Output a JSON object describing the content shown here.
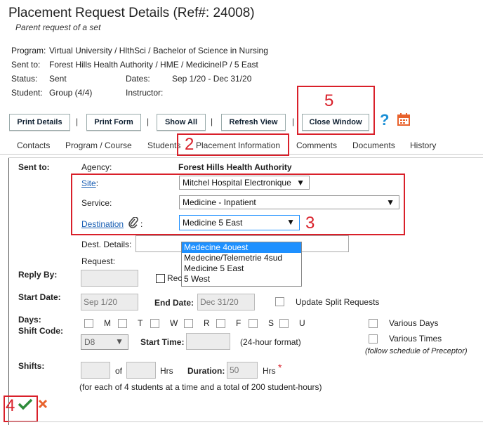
{
  "header": {
    "title": "Placement Request Details (Ref#: 24008)",
    "subtitle": "Parent request of a set"
  },
  "info": {
    "program_label": "Program:",
    "program_value": "Virtual University / HlthSci / Bachelor of Science in Nursing",
    "sentto_label": "Sent to:",
    "sentto_value": "Forest Hills Health Authority / HME / MedicineIP / 5 East",
    "status_label": "Status:",
    "status_value": "Sent",
    "dates_label": "Dates:",
    "dates_value": "Sep 1/20 - Dec 31/20",
    "student_label": "Student:",
    "student_value": "Group (4/4)",
    "instructor_label": "Instructor:"
  },
  "toolbar": {
    "print_details": "Print Details",
    "print_form": "Print Form",
    "show_all": "Show All",
    "refresh_view": "Refresh View",
    "close_window": "Close Window",
    "sep": "|"
  },
  "tabs": [
    "Contacts",
    "Program / Course",
    "Students",
    "Placement Information",
    "Comments",
    "Documents",
    "History"
  ],
  "annotations": {
    "n2": "2",
    "n3": "3",
    "n4": "4",
    "n5": "5"
  },
  "form": {
    "sent_to_label": "Sent to:",
    "agency_label": "Agency:",
    "agency_value": "Forest Hills Health Authority",
    "site_label": "Site",
    "site_colon": ":",
    "site_value": "Mitchel Hospital Electronique",
    "service_label": "Service:",
    "service_value": "Medicine - Inpatient",
    "destination_label": "Destination",
    "destination_colon": ":",
    "destination_value": "Medicine 5 East",
    "dest_details_label": "Dest. Details:",
    "request_label": "Request:",
    "reply_by_label": "Reply By:",
    "req_cut": "Rec",
    "start_date_label": "Start Date:",
    "start_date_value": "Sep 1/20",
    "end_date_label": "End Date:",
    "end_date_value": "Dec 31/20",
    "update_split": "Update Split Requests",
    "days_label": "Days:",
    "shift_code_label": "Shift Code:",
    "days": [
      "M",
      "T",
      "W",
      "R",
      "F",
      "S",
      "U"
    ],
    "various_days": "Various Days",
    "various_times": "Various Times",
    "follow_schedule": "(follow schedule of Preceptor)",
    "shift_code_value": "D8",
    "start_time_label": "Start Time:",
    "format_24": "(24-hour format)",
    "shifts_label": "Shifts:",
    "of_label": "of",
    "hrs_label": "Hrs",
    "duration_label": "Duration:",
    "duration_value": "50",
    "hrs2_label": "Hrs",
    "required_mark": "*",
    "students_note": "(for each of 4 students at a time and a total of 200 student-hours)"
  },
  "dropdown_options": [
    "Medecine 4ouest",
    "Medecine/Telemetrie 4sud",
    "Medicine 5 East",
    "5 West"
  ]
}
